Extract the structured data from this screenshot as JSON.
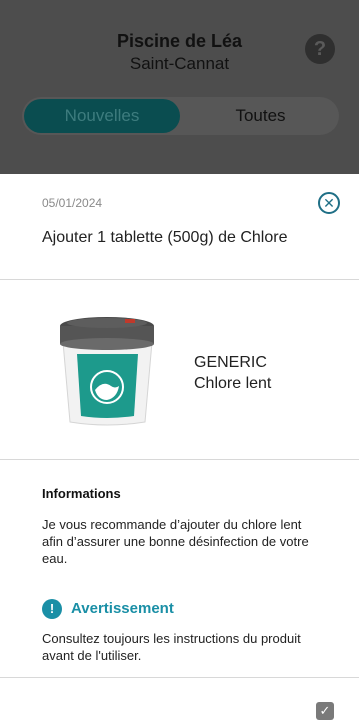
{
  "header": {
    "title": "Piscine de Léa",
    "subtitle": "Saint-Cannat",
    "help_icon": "question-mark-icon",
    "help_label": "?"
  },
  "segmented": {
    "active": "Nouvelles",
    "inactive": "Toutes"
  },
  "sheet": {
    "date": "05/01/2024",
    "close_icon": "close-icon",
    "close_label": "✕",
    "task": "Ajouter 1 tablette (500g) de Chlore",
    "product": {
      "brand": "GENERIC",
      "name": "Chlore lent",
      "image_icon": "chlorine-bucket-icon"
    },
    "info_title": "Informations",
    "info_text": "Je vous recommande d’ajouter du chlore lent afin d’assurer une bonne désinfection de votre eau.",
    "warning_title": "Avertissement",
    "warning_icon_label": "!",
    "warning_text": "Consultez toujours les instructions du produit avant de l'utiliser.",
    "check_icon": "checkbox-icon",
    "check_label": "✓"
  },
  "colors": {
    "accent": "#1a8fa6",
    "overlay": "#4d4d4d",
    "active_segment": "#0a4d50"
  }
}
